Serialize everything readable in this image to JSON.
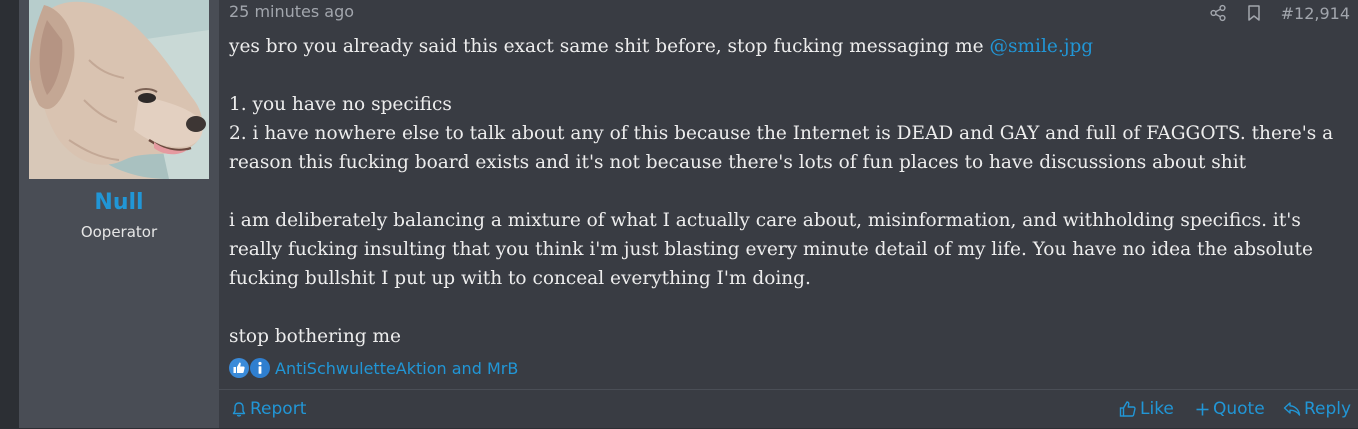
{
  "user": {
    "name": "Null",
    "title": "Ooperator"
  },
  "post": {
    "time": "25 minutes ago",
    "number": "#12,914",
    "line1_text": "yes bro you already said this exact same shit before, stop fucking messaging me ",
    "mention": "@smile.jpg",
    "list_item_1": "1. you have no specifics",
    "list_item_2": "2. i have nowhere else to talk about any of this because the Internet is DEAD and GAY and full of FAGGOTS. there's a reason this fucking board exists and it's not because there's lots of fun places to have discussions about shit",
    "paragraph_2": "i am deliberately balancing a mixture of what I actually care about, misinformation, and withholding specifics. it's really fucking insulting that you think i'm just blasting every minute detail of my life. You have no idea the absolute fucking bullshit I put up with to conceal everything I'm doing.",
    "closing": "stop bothering me"
  },
  "reactions": {
    "icons": [
      "thumbs-up-icon",
      "informative-icon"
    ],
    "text": "AntiSchwuletteAktion and MrB"
  },
  "footer": {
    "report_label": "Report",
    "like_label": "Like",
    "quote_label": "Quote",
    "reply_label": "Reply"
  },
  "colors": {
    "accent": "#2196d6",
    "text": "#ededed",
    "muted": "#a2a6ad",
    "panel": "#494d55",
    "background": "#393c43"
  }
}
